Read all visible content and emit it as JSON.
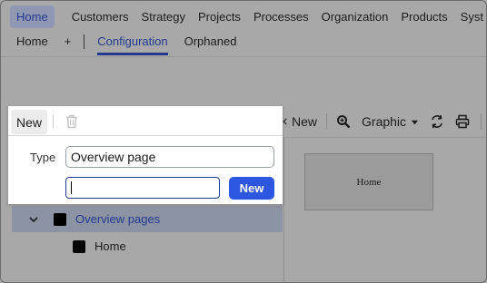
{
  "topnav": {
    "home": "Home",
    "items": [
      "Customers",
      "Strategy",
      "Projects",
      "Processes",
      "Organization",
      "Products",
      "Syst"
    ]
  },
  "subnav": {
    "home": "Home",
    "plus": "+",
    "configuration": "Configuration",
    "orphaned": "Orphaned"
  },
  "toolbar": {
    "new_label": "New",
    "graphic_label": "Graphic"
  },
  "popup": {
    "new_tab": "New",
    "type_label": "Type",
    "type_value": "Overview page",
    "name_value": "",
    "new_button": "New"
  },
  "tree": {
    "group_label": "Overview pages",
    "child_label": "Home"
  },
  "preview": {
    "thumb_label": "Home"
  },
  "colors": {
    "accent": "#233a8f",
    "button": "#2d57e0",
    "overlay": "#a8a8a8"
  }
}
